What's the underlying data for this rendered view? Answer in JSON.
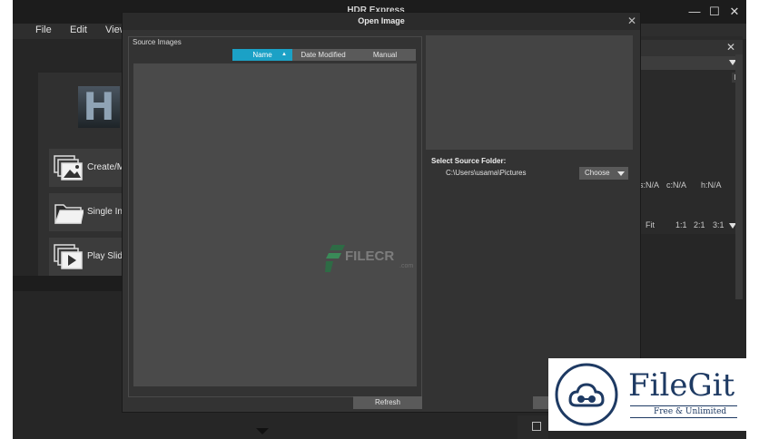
{
  "app": {
    "title": "HDR Express",
    "menu": [
      "File",
      "Edit",
      "View"
    ],
    "left_buttons": [
      {
        "label": "Create/M",
        "icon": "images-stack-icon"
      },
      {
        "label": "Single In",
        "icon": "folder-icon"
      },
      {
        "label": "Play Slid",
        "icon": "slideshow-icon"
      }
    ],
    "window_controls": {
      "minimize": "—",
      "maximize": "☐",
      "close": "✕"
    }
  },
  "right_panel": {
    "h_label": "H",
    "close": "✕",
    "stats": [
      "s:N/A",
      "c:N/A",
      "h:N/A"
    ],
    "zoom": [
      "Fit",
      "1:1",
      "2:1",
      "3:1"
    ]
  },
  "dialog": {
    "title": "Open Image",
    "close": "✕",
    "source_images_label": "Source Images",
    "sort_tabs": [
      {
        "label": "Name",
        "indicator": "▲",
        "active": true
      },
      {
        "label": "Date Modified",
        "active": false
      },
      {
        "label": "Manual",
        "active": false
      }
    ],
    "refresh_label": "Refresh",
    "select_folder_label": "Select Source Folder:",
    "folder_path": "C:\\Users\\usama\\Pictures",
    "choose_label": "Choose"
  },
  "watermarks": {
    "filecr": {
      "text": "FILECR",
      "suffix": ".com"
    },
    "filegit": {
      "title": "FileGit",
      "subtitle": "Free & Unlimited"
    }
  },
  "colors": {
    "accent": "#1ba1c6",
    "filegit_navy": "#1e3a63"
  }
}
